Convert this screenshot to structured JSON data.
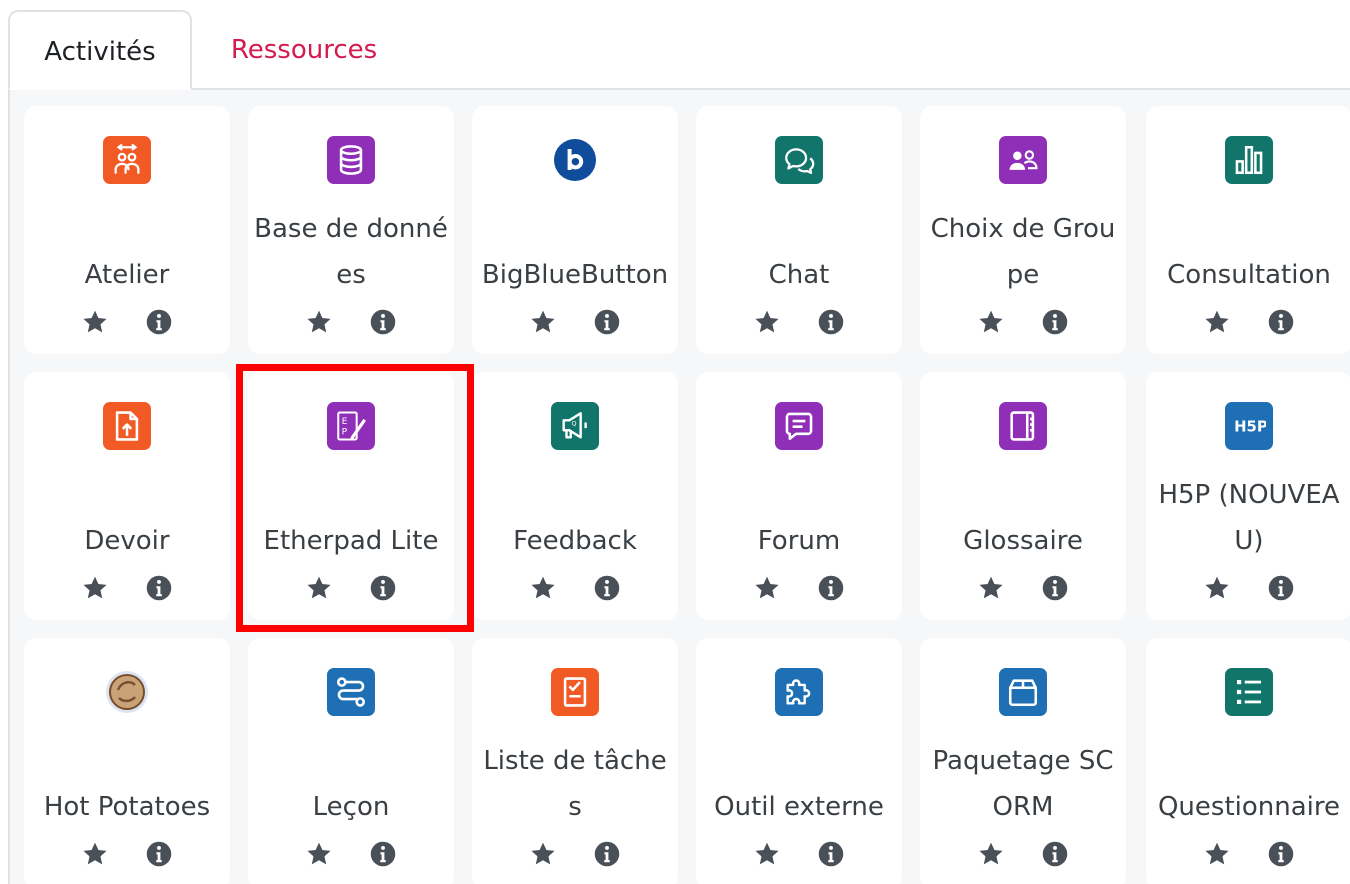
{
  "tabs": {
    "active": "Activités",
    "inactive": "Ressources"
  },
  "colors": {
    "accent_link": "#d41b51",
    "orange": "#f15a24",
    "purple": "#8f2fb8",
    "teal": "#11756b",
    "blue": "#1f6fb4",
    "navy": "#0f4c9b",
    "highlight_border": "#ff0000"
  },
  "activities": [
    {
      "label": "Atelier",
      "icon": "workshop-icon",
      "color": "#f15a24"
    },
    {
      "label": "Base de données",
      "icon": "database-icon",
      "color": "#8f2fb8"
    },
    {
      "label": "BigBlueButton",
      "icon": "bigbluebutton-icon",
      "color": "#0f4c9b"
    },
    {
      "label": "Chat",
      "icon": "chat-icon",
      "color": "#11756b"
    },
    {
      "label": "Choix de Groupe",
      "icon": "group-choice-icon",
      "color": "#8f2fb8"
    },
    {
      "label": "Consultation",
      "icon": "survey-chart-icon",
      "color": "#11756b"
    },
    {
      "label": "Devoir",
      "icon": "assignment-icon",
      "color": "#f15a24"
    },
    {
      "label": "Etherpad Lite",
      "icon": "etherpad-icon",
      "color": "#8f2fb8"
    },
    {
      "label": "Feedback",
      "icon": "megaphone-icon",
      "color": "#11756b"
    },
    {
      "label": "Forum",
      "icon": "forum-icon",
      "color": "#8f2fb8"
    },
    {
      "label": "Glossaire",
      "icon": "glossary-book-icon",
      "color": "#8f2fb8"
    },
    {
      "label": "H5P (NOUVEAU)",
      "icon": "h5p-icon",
      "color": "#1f6fb4"
    },
    {
      "label": "Hot Potatoes",
      "icon": "hotpotatoes-icon",
      "color": "#c8a378"
    },
    {
      "label": "Leçon",
      "icon": "lesson-path-icon",
      "color": "#1f6fb4"
    },
    {
      "label": "Liste de tâches",
      "icon": "checklist-icon",
      "color": "#f15a24"
    },
    {
      "label": "Outil externe",
      "icon": "puzzle-icon",
      "color": "#1f6fb4"
    },
    {
      "label": "Paquetage SCORM",
      "icon": "package-box-icon",
      "color": "#1f6fb4"
    },
    {
      "label": "Questionnaire",
      "icon": "questionnaire-list-icon",
      "color": "#11756b"
    }
  ],
  "highlighted": "Etherpad Lite"
}
